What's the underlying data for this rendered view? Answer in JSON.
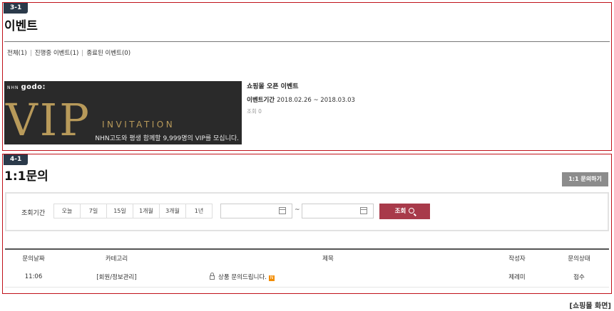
{
  "event_section": {
    "badge": "3-1",
    "title": "이벤트",
    "filters": [
      "전체(1)",
      "진행중 이벤트(1)",
      "종료된 이벤트(0)"
    ],
    "banner": {
      "brand_small": "NHN",
      "brand": "godo:",
      "vip": "VIP",
      "invitation": "INVITATION",
      "copy": "NHN고도와 평생 함께할 9,999명의 VIP를 모십니다."
    },
    "event": {
      "name": "쇼핑몰 오픈 이벤트",
      "period_label": "이벤트기간",
      "period_value": "2018.02.26 ~ 2018.03.03",
      "views": "조회 0"
    }
  },
  "inquiry_section": {
    "badge": "4-1",
    "title": "1:1문의",
    "ask_button": "1:1 문의하기",
    "search": {
      "label": "조회기간",
      "periods": [
        "오늘",
        "7일",
        "15일",
        "1개월",
        "3개월",
        "1년"
      ],
      "date_from": "",
      "date_to": "",
      "tilde": "~",
      "button": "조회"
    },
    "table": {
      "headers": {
        "date": "문의날짜",
        "category": "카테고리",
        "title": "제목",
        "author": "작성자",
        "status": "문의상태"
      },
      "rows": [
        {
          "date": "11:06",
          "category": "[회원/정보관리]",
          "title": "상품 문의드립니다.",
          "new_badge": "N",
          "author": "제레미",
          "status": "접수"
        }
      ]
    }
  },
  "caption": "[쇼핑몰 화면]",
  "colors": {
    "frame": "#c0121a",
    "badge": "#2b3a4a",
    "search_button": "#a83a4a",
    "ask_button": "#8c8c8c",
    "vip_gold": "#b89a5a"
  }
}
